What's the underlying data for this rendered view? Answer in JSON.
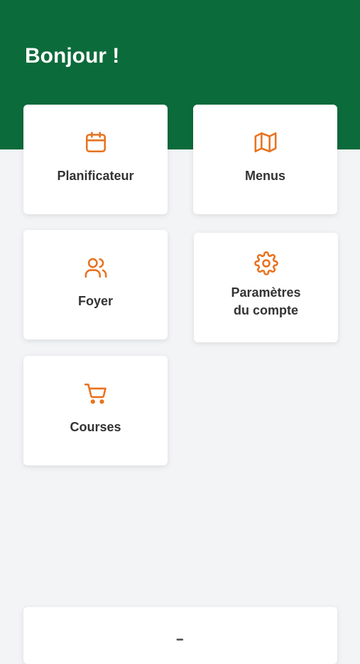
{
  "header": {
    "greeting": "Bonjour !"
  },
  "cards": [
    {
      "label": "Planificateur",
      "icon": "calendar-icon"
    },
    {
      "label": "Menus",
      "icon": "map-icon"
    },
    {
      "label": "Foyer",
      "icon": "users-icon"
    },
    {
      "label": "Paramètres\ndu compte",
      "icon": "gear-icon"
    },
    {
      "label": "Courses",
      "icon": "shopping-cart-icon"
    }
  ],
  "colors": {
    "brand_green": "#0c6b3b",
    "accent_orange": "#e8721e",
    "background": "#f3f4f6",
    "text": "#333333"
  }
}
